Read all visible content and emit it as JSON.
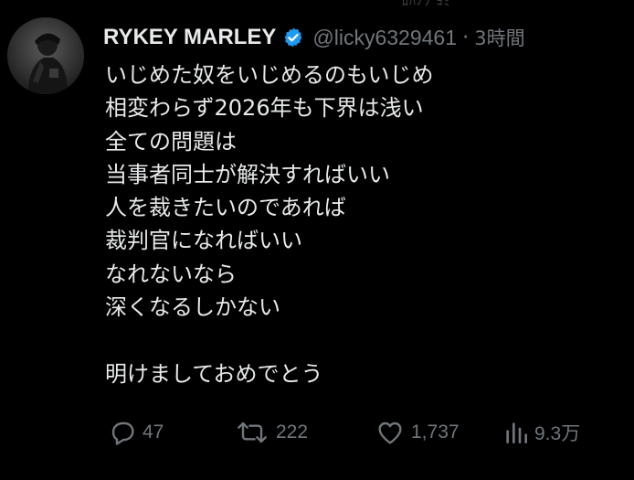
{
  "top_fragment": "ﾛﾊﾉｿ  ﾖﾐ",
  "tweet": {
    "author_name": "RYKEY MARLEY",
    "handle": "@licky6329461",
    "separator": "·",
    "time": "3時間",
    "lines": [
      "いじめた奴をいじめるのもいじめ",
      "相変わらず2026年も下界は浅い",
      "全ての問題は",
      "当事者同士が解決すればいい",
      "人を裁きたいのであれば",
      "裁判官になればいい",
      "なれないなら",
      "深くなるしかない",
      "",
      "明けましておめでとう"
    ]
  },
  "actions": {
    "reply": {
      "icon": "reply-icon",
      "count": "47"
    },
    "retweet": {
      "icon": "retweet-icon",
      "count": "222"
    },
    "like": {
      "icon": "heart-icon",
      "count": "1,737"
    },
    "views": {
      "icon": "views-icon",
      "count": "9.3万"
    }
  },
  "colors": {
    "background": "#000000",
    "text": "#e7e9ea",
    "muted": "#71767b",
    "verified": "#1d9bf0"
  }
}
